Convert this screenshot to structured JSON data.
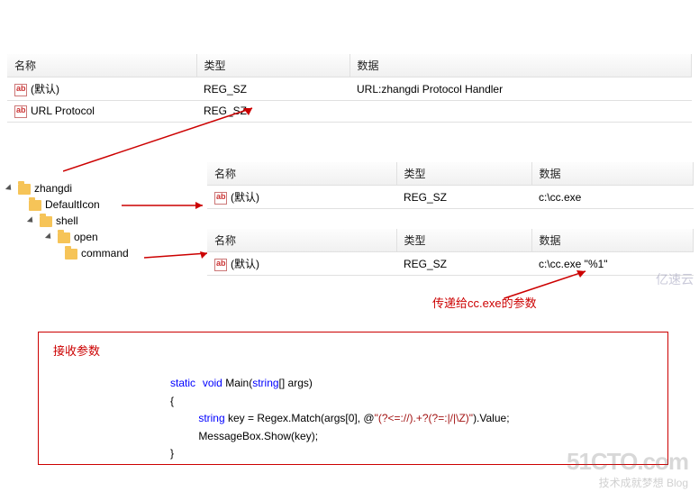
{
  "cols": {
    "name": "名称",
    "type": "类型",
    "data": "数据"
  },
  "table1": {
    "rows": [
      {
        "name": "(默认)",
        "type": "REG_SZ",
        "data": "URL:zhangdi Protocol Handler"
      },
      {
        "name": "URL Protocol",
        "type": "REG_SZ",
        "data": ""
      }
    ]
  },
  "tree": {
    "root": "zhangdi",
    "items": [
      "DefaultIcon",
      "shell",
      "open",
      "command"
    ]
  },
  "table2": {
    "rows": [
      {
        "name": "(默认)",
        "type": "REG_SZ",
        "data": "c:\\cc.exe"
      }
    ]
  },
  "table3": {
    "rows": [
      {
        "name": "(默认)",
        "type": "REG_SZ",
        "data": "c:\\cc.exe \"%1\""
      }
    ]
  },
  "annotation": "传递给cc.exe的参数",
  "codebox": {
    "title": "接收参数",
    "line1_kw1": "static",
    "line1_kw2": "void",
    "line1_main": " Main(",
    "line1_kw3": "string",
    "line1_rest": "[] args)",
    "line2": "{",
    "line3_kw": "string",
    "line3_a": " key = Regex.Match(args[",
    "line3_num": "0",
    "line3_b": "], @",
    "line3_str": "\"(?<=://).+?(?=:|/|\\Z)\"",
    "line3_c": ").Value;",
    "line4": "MessageBox.Show(key);",
    "line5": "}"
  },
  "wm": {
    "main": "51CTO.com",
    "sub": "技术成就梦想   Blog",
    "cloud": "亿速云"
  }
}
